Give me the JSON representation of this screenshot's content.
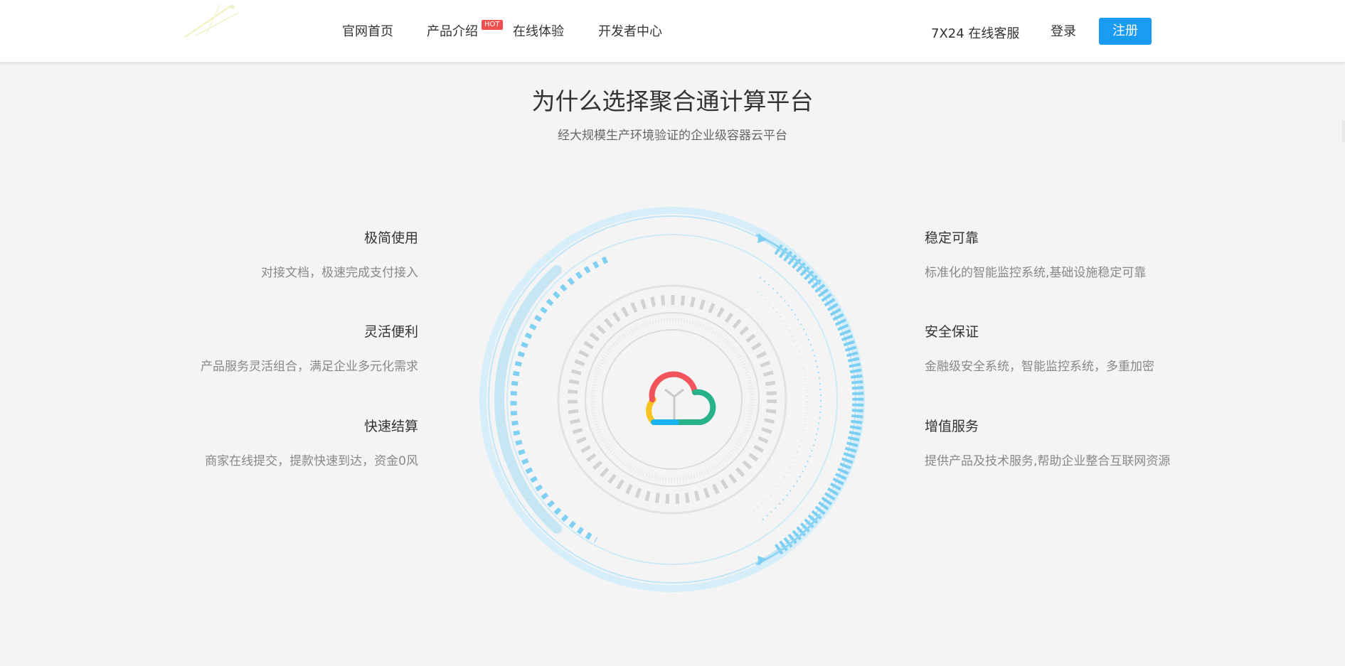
{
  "header": {
    "nav": [
      {
        "label": "官网首页"
      },
      {
        "label": "产品介绍"
      },
      {
        "label": "在线体验"
      },
      {
        "label": "开发者中心"
      }
    ],
    "hot_badge": "HOT",
    "service": "7X24 在线客服",
    "login": "登录",
    "register": "注册",
    "accent_color": "#1a9cf2"
  },
  "section": {
    "title": "为什么选择聚合通计算平台",
    "subtitle": "经大规模生产环境验证的企业级容器云平台"
  },
  "features": {
    "left": [
      {
        "title": "极简使用",
        "desc": "对接文档，极速完成支付接入"
      },
      {
        "title": "灵活便利",
        "desc": "产品服务灵活组合，满足企业多元化需求"
      },
      {
        "title": "快速结算",
        "desc": "商家在线提交，提款快速到达，资金0风"
      }
    ],
    "right": [
      {
        "title": "稳定可靠",
        "desc": "标准化的智能监控系统,基础设施稳定可靠"
      },
      {
        "title": "安全保证",
        "desc": "金融级安全系统，智能监控系统，多重加密"
      },
      {
        "title": "增值服务",
        "desc": "提供产品及技术服务,帮助企业整合互联网资源"
      }
    ]
  },
  "icons": {
    "logo": "logo-icon",
    "center": "cloud-icon"
  }
}
